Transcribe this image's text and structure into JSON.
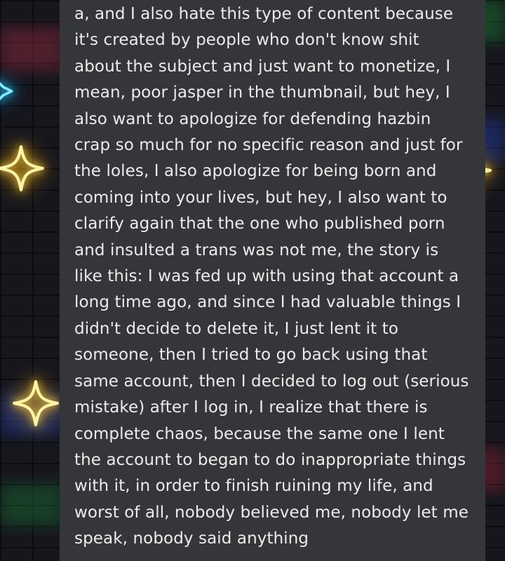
{
  "background": {
    "type": "neon-brick-wallpaper",
    "icons": [
      "sparkle-star-icon",
      "neon-star-icon"
    ],
    "colors": {
      "card": "#35363a",
      "text": "#ececec",
      "neon_yellow": "#ffd84a",
      "neon_teal": "#26d6ff",
      "brick": "#16161d"
    }
  },
  "post": {
    "body": "a, and I also hate this type of content because\nit's created by people who don't know shit\nabout the subject and just want to monetize, I\nmean, poor jasper in the thumbnail, but hey, I\nalso want to apologize for defending hazbin\ncrap so much for no specific reason and just for\nthe loles, I also apologize for being born and\ncoming into your lives, but hey, I also want to\nclarify again that the one who published porn\nand insulted a trans was not me, the story is\nlike this: I was fed up with using that account a\nlong time ago, and since I had valuable things I\ndidn't decide to delete it, I just lent it to\nsomeone, then I tried to go back using that\nsame account, then I decided to log out (serious\nmistake) after I log in, I realize that there is\ncomplete chaos, because the same one I lent\nthe account to began to do inappropriate things\nwith it, in order to finish ruining my life, and\nworst of all, nobody believed me, nobody let me\nspeak, nobody said anything"
  }
}
